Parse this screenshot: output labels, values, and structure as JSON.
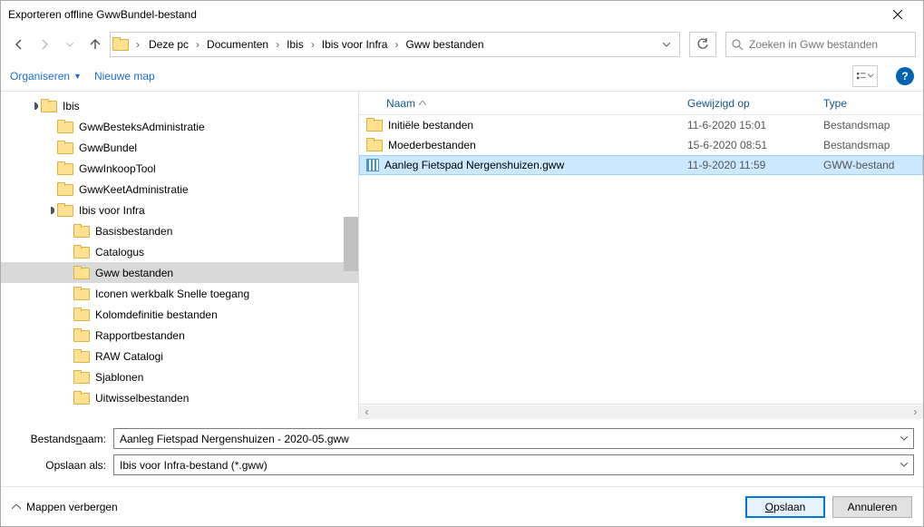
{
  "title": "Exporteren offline GwwBundel-bestand",
  "breadcrumbs": [
    "Deze pc",
    "Documenten",
    "Ibis",
    "Ibis voor Infra",
    "Gww bestanden"
  ],
  "search_placeholder": "Zoeken in Gww bestanden",
  "toolbar": {
    "organize": "Organiseren",
    "new_folder": "Nieuwe map"
  },
  "tree": [
    {
      "label": "Ibis",
      "depth": 0,
      "expandable": true,
      "selected": false
    },
    {
      "label": "GwwBesteksAdministratie",
      "depth": 1,
      "expandable": false,
      "selected": false
    },
    {
      "label": "GwwBundel",
      "depth": 1,
      "expandable": false,
      "selected": false
    },
    {
      "label": "GwwInkoopTool",
      "depth": 1,
      "expandable": false,
      "selected": false
    },
    {
      "label": "GwwKeetAdministratie",
      "depth": 1,
      "expandable": false,
      "selected": false
    },
    {
      "label": "Ibis voor Infra",
      "depth": 1,
      "expandable": true,
      "selected": false
    },
    {
      "label": "Basisbestanden",
      "depth": 2,
      "expandable": false,
      "selected": false
    },
    {
      "label": "Catalogus",
      "depth": 2,
      "expandable": false,
      "selected": false
    },
    {
      "label": "Gww bestanden",
      "depth": 2,
      "expandable": false,
      "selected": true
    },
    {
      "label": "Iconen werkbalk Snelle toegang",
      "depth": 2,
      "expandable": false,
      "selected": false
    },
    {
      "label": "Kolomdefinitie bestanden",
      "depth": 2,
      "expandable": false,
      "selected": false
    },
    {
      "label": "Rapportbestanden",
      "depth": 2,
      "expandable": false,
      "selected": false
    },
    {
      "label": "RAW Catalogi",
      "depth": 2,
      "expandable": false,
      "selected": false
    },
    {
      "label": "Sjablonen",
      "depth": 2,
      "expandable": false,
      "selected": false
    },
    {
      "label": "Uitwisselbestanden",
      "depth": 2,
      "expandable": false,
      "selected": false
    }
  ],
  "columns": {
    "name": "Naam",
    "modified": "Gewijzigd op",
    "type": "Type"
  },
  "files": [
    {
      "name": "Initiële bestanden",
      "modified": "11-6-2020 15:01",
      "type": "Bestandsmap",
      "icon": "folder",
      "selected": false
    },
    {
      "name": "Moederbestanden",
      "modified": "15-6-2020 08:51",
      "type": "Bestandsmap",
      "icon": "folder",
      "selected": false
    },
    {
      "name": "Aanleg Fietspad Nergenshuizen.gww",
      "modified": "11-9-2020 11:59",
      "type": "GWW-bestand",
      "icon": "gww",
      "selected": true
    }
  ],
  "form": {
    "filename_label_pre": "Bestands",
    "filename_label_u": "n",
    "filename_label_post": "aam:",
    "filename_value": "Aanleg Fietspad Nergenshuizen - 2020-05.gww",
    "saveas_label": "Opslaan als:",
    "saveas_value": "Ibis voor Infra-bestand (*.gww)"
  },
  "footer": {
    "hide_folders": "Mappen verbergen",
    "save_u": "O",
    "save_rest": "pslaan",
    "cancel": "Annuleren"
  }
}
